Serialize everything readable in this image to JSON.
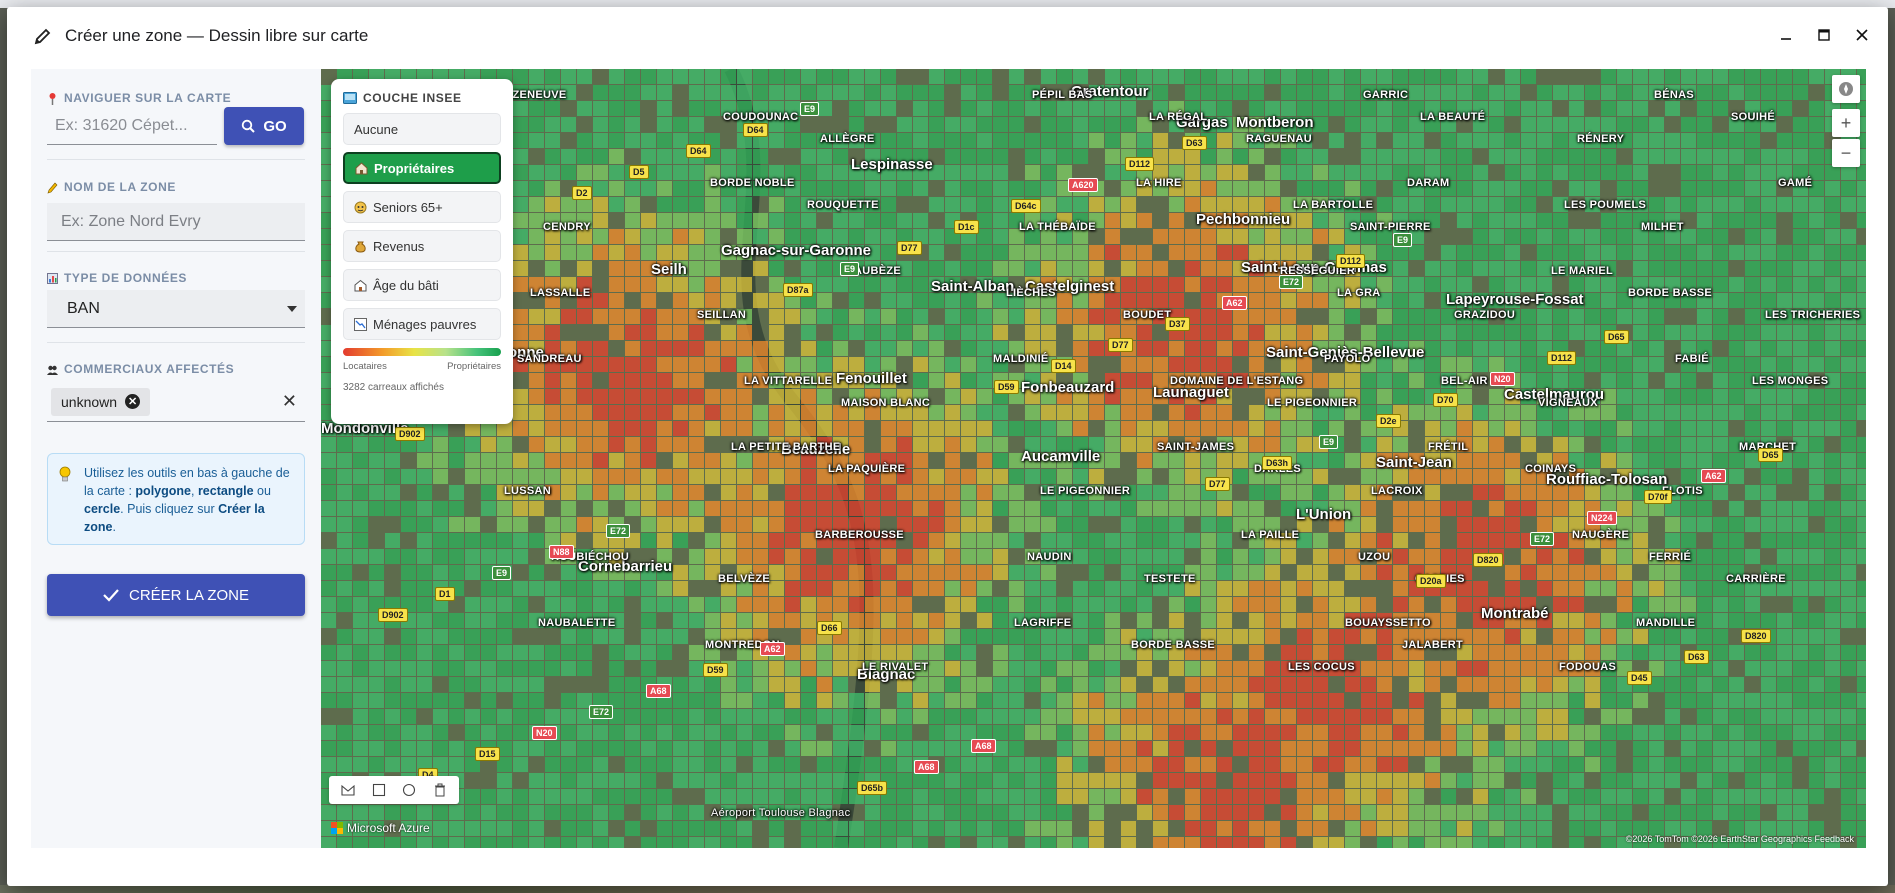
{
  "window": {
    "title": "Créer une zone — Dessin libre sur carte",
    "minimize": "—",
    "maximize": "☐",
    "close": "✕"
  },
  "sidebar": {
    "navigate_label": "NAVIGUER SUR LA CARTE",
    "navigate_placeholder": "Ex: 31620 Cépet...",
    "go_label": "GO",
    "zone_name_label": "NOM DE LA ZONE",
    "zone_name_placeholder": "Ex: Zone Nord Evry",
    "data_type_label": "TYPE DE DONNÉES",
    "data_type_value": "BAN",
    "commercials_label": "COMMERCIAUX AFFECTÉS",
    "chip_value": "unknown",
    "info": {
      "part1": "Utilisez les outils en bas à gauche de la carte : ",
      "polygone": "polygone",
      "sep1": ", ",
      "rectangle": "rectangle",
      "sep2": " ou ",
      "cercle": "cercle",
      "part2": ". Puis cliquez sur ",
      "creer": "Créer la zone",
      "end": "."
    },
    "create_button": "CRÉER LA ZONE"
  },
  "layer_panel": {
    "title": "COUCHE INSEE",
    "options": [
      {
        "label": "Aucune",
        "icon": "none",
        "active": false
      },
      {
        "label": "Propriétaires",
        "icon": "house-icon",
        "active": true
      },
      {
        "label": "Seniors 65+",
        "icon": "elder-icon",
        "active": false
      },
      {
        "label": "Revenus",
        "icon": "money-bag-icon",
        "active": false
      },
      {
        "label": "Âge du bâti",
        "icon": "building-icon",
        "active": false
      },
      {
        "label": "Ménages pauvres",
        "icon": "chart-down-icon",
        "active": false
      }
    ],
    "legend_left": "Locataires",
    "legend_right": "Propriétaires",
    "tiles_count": "3282 carreaux affichés"
  },
  "map": {
    "attribution_logo": "Microsoft Azure",
    "copyright": "©2026 TomTom ©2026 EarthStar Geographics Feedback",
    "zoom_in": "+",
    "zoom_out": "−",
    "places_big": [
      "Gratentour",
      "Gargas",
      "Montberon",
      "Lespinasse",
      "Pechbonnieu",
      "Saint-Loup-Cammas",
      "Seilh",
      "Gagnac-sur-Garonne",
      "Saint-Alban",
      "Castelginest",
      "Lapeyrouse-Fossat",
      "Saint-Geniès-Bellevue",
      "Fenouillet",
      "Fonbeauzard",
      "Launaguet",
      "Castelmaurou",
      "Mondonville",
      "Beauzelle",
      "Aucamville",
      "Saint-Jean",
      "Rouffiac-Tolosan",
      "L'Union",
      "Cornebarrieu",
      "Blagnac",
      "Montrabé",
      "…onne"
    ],
    "places_small": [
      "CAZENEUVE",
      "COUDOUNAC",
      "ALLÈGRE",
      "PÉPIL BAS",
      "LA RÉGAL",
      "RAGUENAU",
      "GARRIC",
      "LA BEAUTÉ",
      "RÉNERY",
      "BÉNAS",
      "SOUIHÉ",
      "CENDRY",
      "BORDE NOBLE",
      "ROUQUETTE",
      "LA THÉBAÏDE",
      "LA HIRE",
      "LA BARTOLLE",
      "SAINT-PIERRE",
      "DARAM",
      "LES POUMELS",
      "MILHET",
      "GAMÉ",
      "LASSALLE",
      "SEILLAN",
      "AUBÈZE",
      "LIÈCHES",
      "BOUDET",
      "RESSÉGUIER",
      "LA GRA",
      "GRAZIDOU",
      "LE MARIEL",
      "BORDE BASSE",
      "LES TRICHERIES",
      "SANDREAU",
      "LA VITTARELLE",
      "MAISON BLANC",
      "MALDINIÉ",
      "DOMAINE DE L'ESTANG",
      "LE PIGEONNIER",
      "PAYOLO",
      "BEL-AIR",
      "VIGNEAUX",
      "FABIÉ",
      "LES MONGES",
      "LUSSAN",
      "LA PETITE BARTHE",
      "LA PAQUIÈRE",
      "LE PIGEONNIER",
      "SAINT-JAMES",
      "DARLES",
      "LACROIX",
      "FRÉTIL",
      "COINAYS",
      "FLOTIS",
      "MARCHET",
      "ROUBIÉCHOU",
      "BELVÈZE",
      "BARBEROUSSE",
      "NAUDIN",
      "TESTETE",
      "LA PAILLE",
      "UZOU",
      "CASTIES",
      "NAUGÈRE",
      "FERRIÉ",
      "CARRIÈRE",
      "NAUBALETTE",
      "MONTREDON",
      "LE RIVALET",
      "LAGRIFFE",
      "BORDE BASSE",
      "LES COCUS",
      "BOUAYSSETTO",
      "JALABERT",
      "FODOUAS",
      "MANDILLE"
    ],
    "roads": [
      "E72",
      "D2",
      "D87a",
      "D59",
      "D77",
      "D20a",
      "D45",
      "D4",
      "D5",
      "E9",
      "D14",
      "D63h",
      "D820",
      "D63",
      "D15",
      "D64",
      "D77",
      "D77",
      "E9",
      "E72",
      "D820",
      "N20",
      "D64",
      "D1c",
      "D37",
      "D2e",
      "N224",
      "D902",
      "E72",
      "E9",
      "D64c",
      "A62",
      "D70",
      "D70f",
      "D1",
      "A68",
      "D65b",
      "A620",
      "E72",
      "N20",
      "A62",
      "E9",
      "D59",
      "A68",
      "D112",
      "D112",
      "D112",
      "D65",
      "N88",
      "A62",
      "A68",
      "D63",
      "E9",
      "D65",
      "D902",
      "E72",
      "D66"
    ],
    "airport_label": "Aéroport Toulouse Blagnac"
  }
}
